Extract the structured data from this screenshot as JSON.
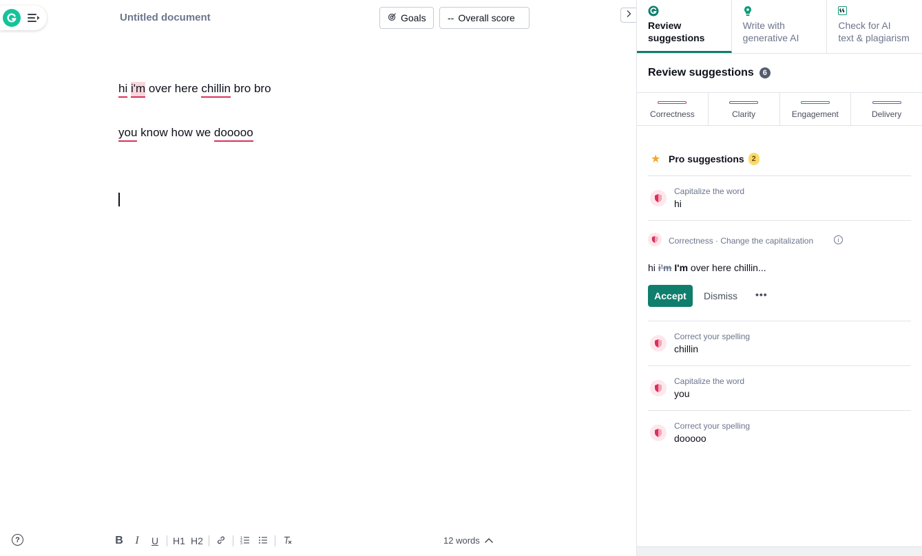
{
  "document": {
    "title": "Untitled document",
    "line1": [
      {
        "text": "hi",
        "style": "err"
      },
      {
        "text": " ",
        "style": ""
      },
      {
        "text": "i'm",
        "style": "err-hl"
      },
      {
        "text": " over here ",
        "style": ""
      },
      {
        "text": "chillin",
        "style": "err"
      },
      {
        "text": " bro bro",
        "style": ""
      }
    ],
    "line2": [
      {
        "text": "you",
        "style": "err"
      },
      {
        "text": " know how we ",
        "style": ""
      },
      {
        "text": "dooooo",
        "style": "err"
      }
    ]
  },
  "header": {
    "goals_label": "Goals",
    "score_prefix": "--",
    "score_label": "Overall score"
  },
  "toolbar": {
    "bold": "B",
    "italic": "I",
    "underline": "U",
    "h1": "H1",
    "h2": "H2",
    "word_count": "12 words"
  },
  "panel": {
    "tabs": [
      {
        "label_line1": "Review",
        "label_line2": "suggestions"
      },
      {
        "label_line1": "Write with",
        "label_line2": "generative AI"
      },
      {
        "label_line1": "Check for AI",
        "label_line2": "text & plagiarism"
      }
    ],
    "title": "Review suggestions",
    "count": "6",
    "categories": [
      {
        "label": "Correctness",
        "color": "#d9315a"
      },
      {
        "label": "Clarity",
        "color": "#3b6dcc"
      },
      {
        "label": "Engagement",
        "color": "#0f9b7a"
      },
      {
        "label": "Delivery",
        "color": "#7b4fd1"
      }
    ],
    "pro": {
      "label": "Pro suggestions",
      "count": "2"
    },
    "suggestions": [
      {
        "title": "Capitalize the word",
        "word": "hi"
      },
      {
        "title": "Correct your spelling",
        "word": "chillin"
      },
      {
        "title": "Capitalize the word",
        "word": "you"
      },
      {
        "title": "Correct your spelling",
        "word": "dooooo"
      }
    ],
    "expanded": {
      "header": "Correctness · Change the capitalization",
      "prefix": "hi ",
      "strike": "i'm",
      "replacement": "I'm",
      "suffix": " over here chillin...",
      "accept": "Accept",
      "dismiss": "Dismiss",
      "more": "•••"
    }
  }
}
